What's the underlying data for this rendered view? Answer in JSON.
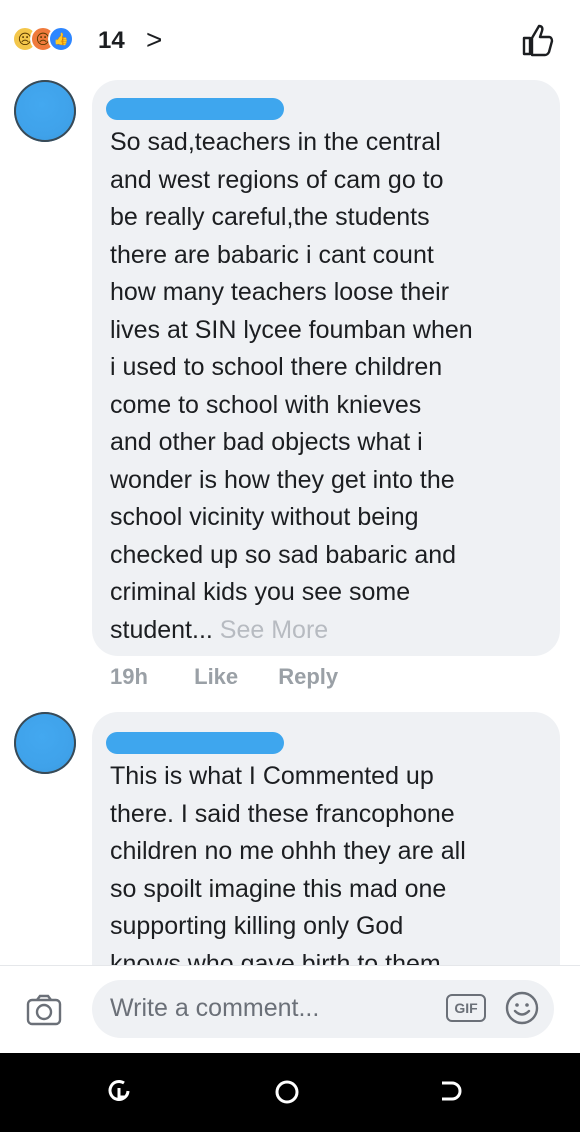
{
  "reactions": {
    "icons": [
      "sad-reaction-icon",
      "angry-reaction-icon",
      "like-reaction-icon"
    ],
    "count": "14",
    "chevron": ">"
  },
  "comments": [
    {
      "name_redacted": true,
      "text": "So sad,teachers in the central\nand west regions of cam go to\nbe really careful,the students\nthere are babaric i cant count\nhow many teachers loose their\nlives at SIN lycee foumban when\ni used to school there children\ncome to school with knieves\nand other bad objects what i\nwonder is how they get into the\nschool vicinity without being\nchecked up so sad babaric and\ncriminal kids you see some\nstudent...",
      "see_more": " See More",
      "time": "19h",
      "like_label": "Like",
      "reply_label": "Reply"
    },
    {
      "name_redacted": true,
      "text": "This is what I Commented up\nthere. I said these francophone\nchildren no me ohhh they are all\nso spoilt imagine this mad one\nsupporting killing only God\nknows who gave birth to them"
    }
  ],
  "composer": {
    "placeholder": "Write a comment...",
    "gif_label": "GIF"
  },
  "colors": {
    "bubble": "#eff1f4",
    "avatar": "#3fa2ea",
    "redaction": "#3ea6ee",
    "muted_text": "#9aa0a6"
  }
}
